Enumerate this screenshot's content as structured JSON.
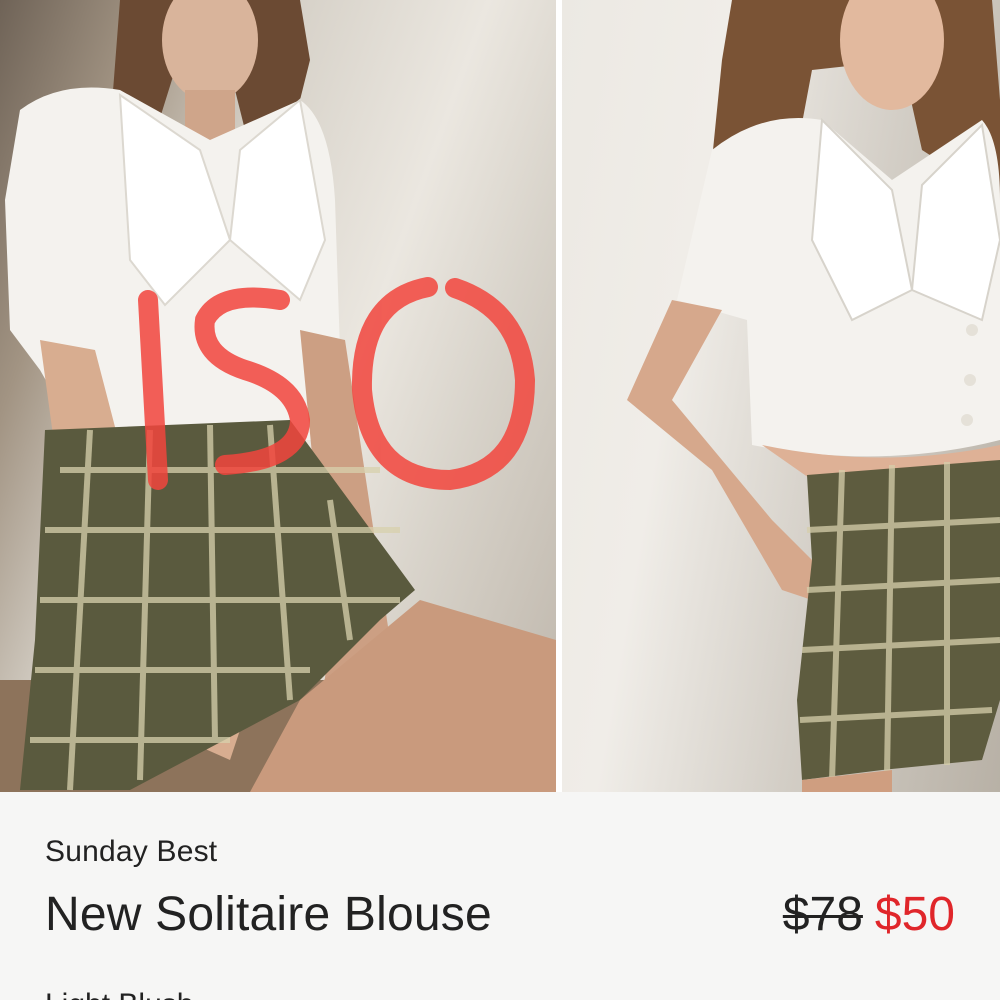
{
  "product": {
    "brand": "Sunday Best",
    "title": "New Solitaire Blouse",
    "price_original": "$78",
    "price_sale": "$50",
    "color": "Light Blush"
  },
  "gallery": {
    "images": [
      {
        "overlay_text": "ISO",
        "overlay_color": "#f2453d"
      },
      {
        "overlay_text": ""
      }
    ]
  },
  "colors": {
    "sale_price": "#e0262a",
    "text": "#222222",
    "background": "#f6f6f5"
  }
}
